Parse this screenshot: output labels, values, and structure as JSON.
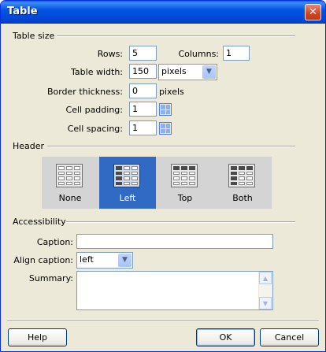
{
  "window": {
    "title": "Table",
    "close_glyph": "✕"
  },
  "table_size": {
    "section_label": "Table size",
    "rows_label": "Rows:",
    "rows_value": "5",
    "columns_label": "Columns:",
    "columns_value": "1",
    "width_label": "Table width:",
    "width_value": "150",
    "width_unit": "pixels",
    "border_label": "Border thickness:",
    "border_value": "0",
    "border_unit": "pixels",
    "padding_label": "Cell padding:",
    "padding_value": "1",
    "spacing_label": "Cell spacing:",
    "spacing_value": "1"
  },
  "header": {
    "section_label": "Header",
    "options": [
      {
        "label": "None",
        "selected": false
      },
      {
        "label": "Left",
        "selected": true
      },
      {
        "label": "Top",
        "selected": false
      },
      {
        "label": "Both",
        "selected": false
      }
    ]
  },
  "accessibility": {
    "section_label": "Accessibility",
    "caption_label": "Caption:",
    "caption_value": "",
    "align_label": "Align caption:",
    "align_value": "left",
    "summary_label": "Summary:",
    "summary_value": ""
  },
  "buttons": {
    "help": "Help",
    "ok": "OK",
    "cancel": "Cancel"
  },
  "colors": {
    "titlebar": "#0055e5",
    "selected": "#316ac5",
    "dialog_bg": "#ece9d8"
  }
}
